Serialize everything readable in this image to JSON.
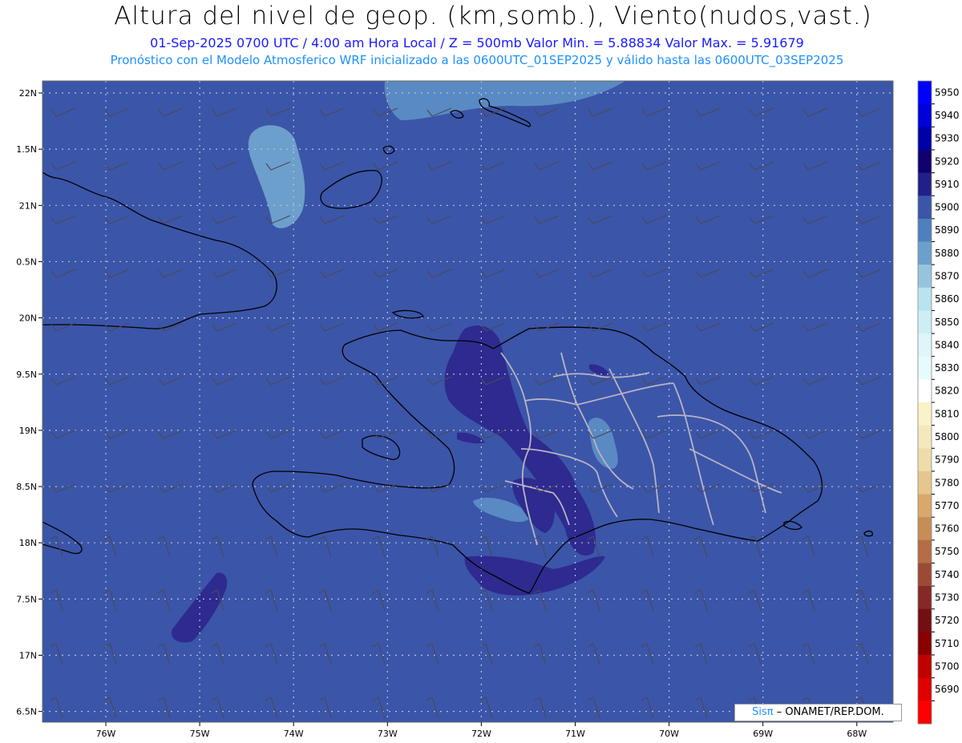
{
  "header": {
    "title": "Altura del nivel de geop. (km,somb.), Viento(nudos,vast.)",
    "line1": "01-Sep-2025  0700 UTC / 4:00 am Hora Local / Z = 500mb    Valor Min. = 5.88834  Valor Max. = 5.91679",
    "line2": "Pronóstico con el Modelo Atmosferico WRF inicializado a las 0600UTC_01SEP2025 y válido hasta las  0600UTC_03SEP2025"
  },
  "axes": {
    "lat_labels": [
      "22N",
      "1.5N",
      "21N",
      "0.5N",
      "20N",
      "9.5N",
      "19N",
      "8.5N",
      "18N",
      "7.5N",
      "17N",
      "6.5N"
    ],
    "lon_labels": [
      "76W",
      "75W",
      "74W",
      "73W",
      "72W",
      "71W",
      "70W",
      "69W",
      "68W"
    ]
  },
  "colorbar": {
    "labels": [
      "5950",
      "5940",
      "5930",
      "5920",
      "5910",
      "5900",
      "5890",
      "5880",
      "5870",
      "5860",
      "5850",
      "5840",
      "5830",
      "5820",
      "5810",
      "5800",
      "5790",
      "5780",
      "5770",
      "5760",
      "5750",
      "5740",
      "5730",
      "5720",
      "5710",
      "5700",
      "5690"
    ],
    "colors": [
      "#0000ff",
      "#0000d9",
      "#0000a8",
      "#100070",
      "#221f8a",
      "#3b55a8",
      "#4f7fbc",
      "#6d9fcc",
      "#97c4dd",
      "#b9e3ef",
      "#cdeef5",
      "#dff5f8",
      "#e6fbfb",
      "#ffffff",
      "#fbf2c9",
      "#f6e8bd",
      "#eedcaa",
      "#e6c68e",
      "#d9a86a",
      "#c68d56",
      "#b46d45",
      "#9c4a36",
      "#852826",
      "#720f12",
      "#8a0000",
      "#c00000",
      "#e00000",
      "#ff0000"
    ]
  },
  "map_colors": {
    "background": "#3b55a8",
    "light": "#5a8ac3",
    "dark": "#2e2a8f"
  },
  "credit": {
    "sis": "Sisπ",
    "rest": "– ONAMET/REP.DOM."
  }
}
